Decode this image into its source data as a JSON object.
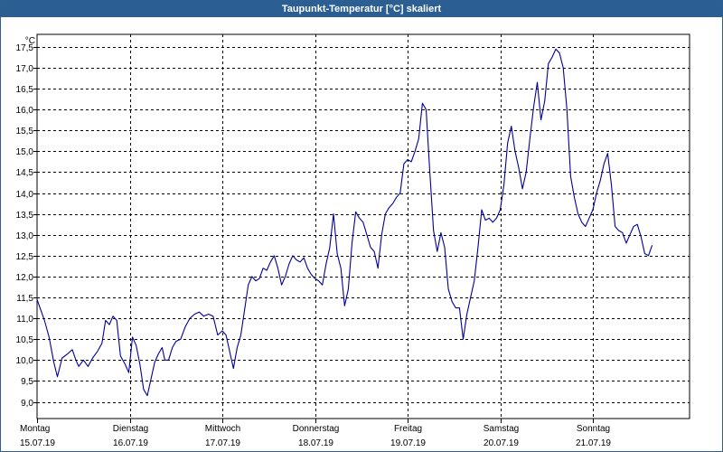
{
  "window": {
    "title": "Taupunkt-Temperatur [°C] skaliert"
  },
  "chart_data": {
    "type": "line",
    "title": "Taupunkt-Temperatur [°C] skaliert",
    "ylabel": "°C",
    "ylim": [
      8.6,
      17.8
    ],
    "grid": true,
    "yticks": [
      9.0,
      9.5,
      10.0,
      10.5,
      11.0,
      11.5,
      12.0,
      12.5,
      13.0,
      13.5,
      14.0,
      14.5,
      15.0,
      15.5,
      16.0,
      16.5,
      17.0,
      17.5
    ],
    "days": [
      {
        "weekday": "Montag",
        "date": "15.07.19"
      },
      {
        "weekday": "Dienstag",
        "date": "16.07.19"
      },
      {
        "weekday": "Mittwoch",
        "date": "17.07.19"
      },
      {
        "weekday": "Donnerstag",
        "date": "18.07.19"
      },
      {
        "weekday": "Freitag",
        "date": "19.07.19"
      },
      {
        "weekday": "Samstag",
        "date": "20.07.19"
      },
      {
        "weekday": "Sonntag",
        "date": "21.07.19"
      }
    ],
    "x_unit": "days since 15.07.19 00:00",
    "series": [
      {
        "name": "",
        "color": "#000099",
        "points": [
          [
            0.0,
            11.45
          ],
          [
            0.08,
            10.95
          ],
          [
            0.13,
            10.55
          ],
          [
            0.18,
            9.95
          ],
          [
            0.22,
            9.6
          ],
          [
            0.27,
            10.05
          ],
          [
            0.33,
            10.15
          ],
          [
            0.38,
            10.25
          ],
          [
            0.42,
            10.0
          ],
          [
            0.45,
            9.85
          ],
          [
            0.5,
            10.0
          ],
          [
            0.55,
            9.85
          ],
          [
            0.6,
            10.05
          ],
          [
            0.65,
            10.2
          ],
          [
            0.7,
            10.4
          ],
          [
            0.74,
            10.95
          ],
          [
            0.78,
            10.85
          ],
          [
            0.82,
            11.05
          ],
          [
            0.86,
            10.95
          ],
          [
            0.9,
            10.1
          ],
          [
            0.95,
            9.9
          ],
          [
            0.99,
            9.7
          ],
          [
            1.03,
            10.55
          ],
          [
            1.07,
            10.35
          ],
          [
            1.11,
            9.9
          ],
          [
            1.15,
            9.3
          ],
          [
            1.19,
            9.15
          ],
          [
            1.23,
            9.55
          ],
          [
            1.27,
            9.95
          ],
          [
            1.31,
            10.15
          ],
          [
            1.35,
            10.3
          ],
          [
            1.38,
            10.0
          ],
          [
            1.42,
            10.0
          ],
          [
            1.46,
            10.3
          ],
          [
            1.5,
            10.45
          ],
          [
            1.55,
            10.5
          ],
          [
            1.6,
            10.8
          ],
          [
            1.65,
            11.0
          ],
          [
            1.7,
            11.1
          ],
          [
            1.75,
            11.15
          ],
          [
            1.8,
            11.05
          ],
          [
            1.85,
            11.1
          ],
          [
            1.9,
            11.05
          ],
          [
            1.95,
            10.6
          ],
          [
            2.0,
            10.7
          ],
          [
            2.04,
            10.6
          ],
          [
            2.08,
            10.2
          ],
          [
            2.12,
            9.8
          ],
          [
            2.16,
            10.3
          ],
          [
            2.2,
            10.6
          ],
          [
            2.24,
            11.2
          ],
          [
            2.28,
            11.8
          ],
          [
            2.32,
            12.0
          ],
          [
            2.36,
            11.9
          ],
          [
            2.4,
            11.95
          ],
          [
            2.44,
            12.2
          ],
          [
            2.48,
            12.15
          ],
          [
            2.52,
            12.35
          ],
          [
            2.56,
            12.5
          ],
          [
            2.6,
            12.2
          ],
          [
            2.64,
            11.8
          ],
          [
            2.68,
            12.0
          ],
          [
            2.72,
            12.3
          ],
          [
            2.76,
            12.5
          ],
          [
            2.8,
            12.4
          ],
          [
            2.84,
            12.35
          ],
          [
            2.88,
            12.45
          ],
          [
            2.92,
            12.2
          ],
          [
            2.96,
            12.05
          ],
          [
            3.0,
            11.95
          ],
          [
            3.04,
            11.9
          ],
          [
            3.08,
            11.8
          ],
          [
            3.12,
            12.3
          ],
          [
            3.16,
            12.7
          ],
          [
            3.2,
            13.5
          ],
          [
            3.24,
            12.55
          ],
          [
            3.28,
            12.2
          ],
          [
            3.32,
            11.3
          ],
          [
            3.36,
            11.7
          ],
          [
            3.4,
            12.8
          ],
          [
            3.44,
            13.55
          ],
          [
            3.48,
            13.4
          ],
          [
            3.52,
            13.3
          ],
          [
            3.56,
            13.0
          ],
          [
            3.6,
            12.7
          ],
          [
            3.64,
            12.6
          ],
          [
            3.68,
            12.2
          ],
          [
            3.72,
            13.0
          ],
          [
            3.76,
            13.5
          ],
          [
            3.8,
            13.65
          ],
          [
            3.84,
            13.75
          ],
          [
            3.88,
            13.9
          ],
          [
            3.92,
            14.0
          ],
          [
            3.96,
            14.7
          ],
          [
            4.0,
            14.8
          ],
          [
            4.04,
            14.75
          ],
          [
            4.08,
            15.0
          ],
          [
            4.12,
            15.3
          ],
          [
            4.16,
            16.15
          ],
          [
            4.2,
            16.0
          ],
          [
            4.24,
            14.5
          ],
          [
            4.28,
            13.1
          ],
          [
            4.32,
            12.6
          ],
          [
            4.36,
            13.05
          ],
          [
            4.4,
            12.7
          ],
          [
            4.44,
            11.7
          ],
          [
            4.48,
            11.4
          ],
          [
            4.52,
            11.25
          ],
          [
            4.56,
            11.25
          ],
          [
            4.6,
            10.5
          ],
          [
            4.64,
            11.1
          ],
          [
            4.68,
            11.5
          ],
          [
            4.72,
            11.9
          ],
          [
            4.76,
            12.7
          ],
          [
            4.8,
            13.6
          ],
          [
            4.84,
            13.35
          ],
          [
            4.88,
            13.4
          ],
          [
            4.92,
            13.3
          ],
          [
            4.96,
            13.4
          ],
          [
            5.0,
            13.6
          ],
          [
            5.04,
            14.2
          ],
          [
            5.08,
            15.2
          ],
          [
            5.12,
            15.6
          ],
          [
            5.16,
            15.0
          ],
          [
            5.2,
            14.6
          ],
          [
            5.24,
            14.1
          ],
          [
            5.28,
            14.5
          ],
          [
            5.32,
            15.3
          ],
          [
            5.36,
            16.05
          ],
          [
            5.4,
            16.65
          ],
          [
            5.44,
            15.75
          ],
          [
            5.48,
            16.2
          ],
          [
            5.52,
            17.1
          ],
          [
            5.56,
            17.25
          ],
          [
            5.6,
            17.45
          ],
          [
            5.64,
            17.35
          ],
          [
            5.68,
            17.0
          ],
          [
            5.72,
            16.0
          ],
          [
            5.76,
            14.4
          ],
          [
            5.8,
            13.9
          ],
          [
            5.84,
            13.5
          ],
          [
            5.88,
            13.3
          ],
          [
            5.92,
            13.2
          ],
          [
            5.96,
            13.4
          ],
          [
            6.0,
            13.6
          ],
          [
            6.04,
            14.0
          ],
          [
            6.08,
            14.3
          ],
          [
            6.12,
            14.7
          ],
          [
            6.16,
            14.95
          ],
          [
            6.2,
            14.2
          ],
          [
            6.24,
            13.2
          ],
          [
            6.28,
            13.1
          ],
          [
            6.32,
            13.05
          ],
          [
            6.36,
            12.8
          ],
          [
            6.4,
            13.0
          ],
          [
            6.44,
            13.2
          ],
          [
            6.48,
            13.25
          ],
          [
            6.52,
            12.95
          ],
          [
            6.56,
            12.55
          ],
          [
            6.6,
            12.5
          ],
          [
            6.64,
            12.75
          ]
        ]
      }
    ]
  }
}
